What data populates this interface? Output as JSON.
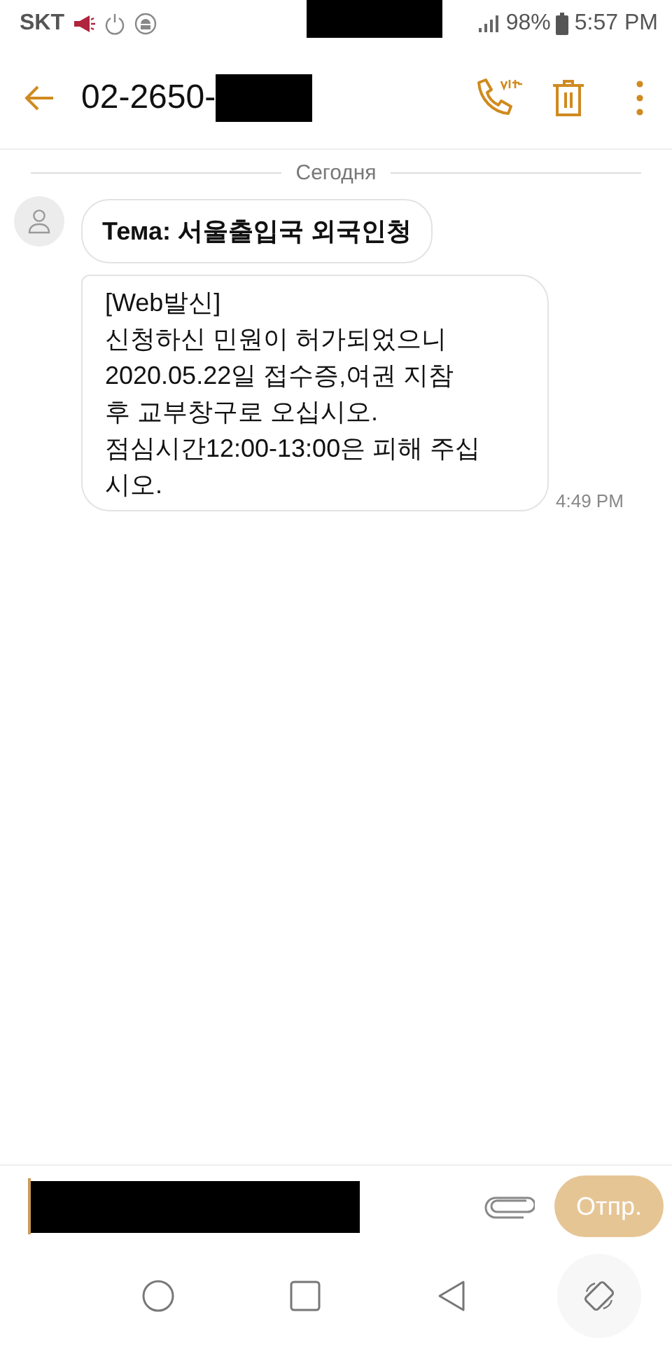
{
  "status_bar": {
    "carrier": "SKT",
    "battery": "98%",
    "time": "5:57 PM"
  },
  "header": {
    "title": "02-2650-"
  },
  "date_separator": "Сегодня",
  "messages": [
    {
      "subject": "Тема: 서울출입국 외국인청",
      "body": "[Web발신]\n신청하신 민원이 허가되었으니\n2020.05.22일 접수증,여권 지참\n후 교부창구로 오십시오.\n점심시간12:00-13:00은 피해 주십\n시오.",
      "time": "4:49 PM"
    }
  ],
  "composer": {
    "send_button": {
      "label": "Отпр.",
      "disabled": true
    }
  }
}
